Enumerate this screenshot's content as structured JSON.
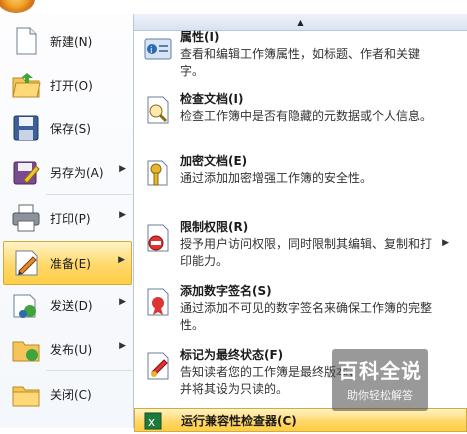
{
  "left_menu": [
    {
      "label": "新建(N)",
      "icon": "new-document-icon",
      "arrow": false,
      "selected": false
    },
    {
      "label": "打开(O)",
      "icon": "open-folder-icon",
      "arrow": false,
      "selected": false
    },
    {
      "label": "保存(S)",
      "icon": "save-disk-icon",
      "arrow": false,
      "selected": false
    },
    {
      "label": "另存为(A)",
      "icon": "save-as-icon",
      "arrow": true,
      "selected": false
    },
    {
      "label": "打印(P)",
      "icon": "printer-icon",
      "arrow": true,
      "selected": false
    },
    {
      "label": "准备(E)",
      "icon": "prepare-pencil-icon",
      "arrow": true,
      "selected": true
    },
    {
      "label": "发送(D)",
      "icon": "send-icon",
      "arrow": true,
      "selected": false
    },
    {
      "label": "发布(U)",
      "icon": "publish-folder-icon",
      "arrow": true,
      "selected": false
    },
    {
      "label": "关闭(C)",
      "icon": "close-folder-icon",
      "arrow": false,
      "selected": false
    }
  ],
  "submenu": {
    "scroll_up_glyph": "▲",
    "entries": [
      {
        "title": "属性(I)",
        "desc": "查看和编辑工作簿属性，如标题、作者和关键字。",
        "icon": "properties-icon",
        "arrow": false
      },
      {
        "title": "检查文档(I)",
        "desc": "检查工作簿中是否有隐藏的元数据或个人信息。",
        "icon": "inspect-document-icon",
        "arrow": false
      },
      {
        "title": "加密文档(E)",
        "desc": "通过添加加密增强工作簿的安全性。",
        "icon": "encrypt-key-icon",
        "arrow": false
      },
      {
        "title": "限制权限(R)",
        "desc": "授予用户访问权限，同时限制其编辑、复制和打印能力。",
        "icon": "restrict-permission-icon",
        "arrow": true
      },
      {
        "title": "添加数字签名(S)",
        "desc": "通过添加不可见的数字签名来确保工作簿的完整性。",
        "icon": "digital-signature-icon",
        "arrow": false
      },
      {
        "title": "标记为最终状态(F)",
        "desc": "告知读者您的工作簿是最终版本，并将其设为只读的。",
        "icon": "mark-final-icon",
        "arrow": false
      },
      {
        "title": "运行兼容性检查器(C)",
        "desc": "",
        "icon": "compatibility-checker-icon",
        "arrow": false,
        "active": true
      }
    ]
  },
  "watermark": {
    "main": "百科全说",
    "sub": "助你轻松解答"
  },
  "colors": {
    "highlight": "#ffd86a",
    "border": "#d6a93b",
    "pane_border": "#b7c7dc"
  }
}
